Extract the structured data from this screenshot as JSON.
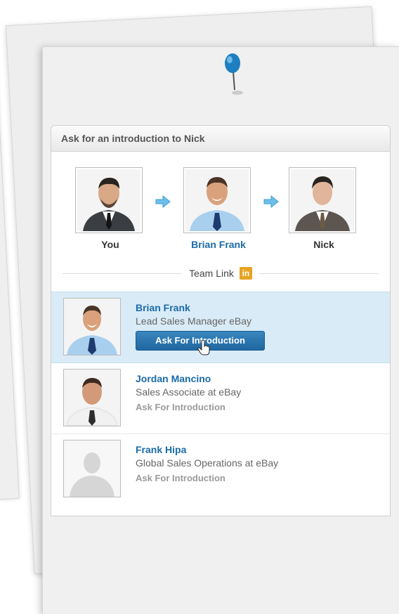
{
  "panel": {
    "header": "Ask for an introduction to Nick"
  },
  "path": {
    "you": "You",
    "middle": "Brian Frank",
    "target": "Nick"
  },
  "team_link": {
    "label": "Team Link",
    "icon_text": "in"
  },
  "connections": [
    {
      "name": "Brian Frank",
      "title": "Lead Sales Manager eBay",
      "action": "Ask For Introduction"
    },
    {
      "name": "Jordan Mancino",
      "title": "Sales Associate at eBay",
      "action": "Ask For Introduction"
    },
    {
      "name": "Frank Hipa",
      "title": "Global Sales Operations at eBay",
      "action": "Ask For Introduction"
    }
  ],
  "colors": {
    "link_blue": "#1a6aa8",
    "selected_row": "#d9ebf6",
    "button_blue": "#2a74ad",
    "linkedin_orange": "#e8a322"
  }
}
